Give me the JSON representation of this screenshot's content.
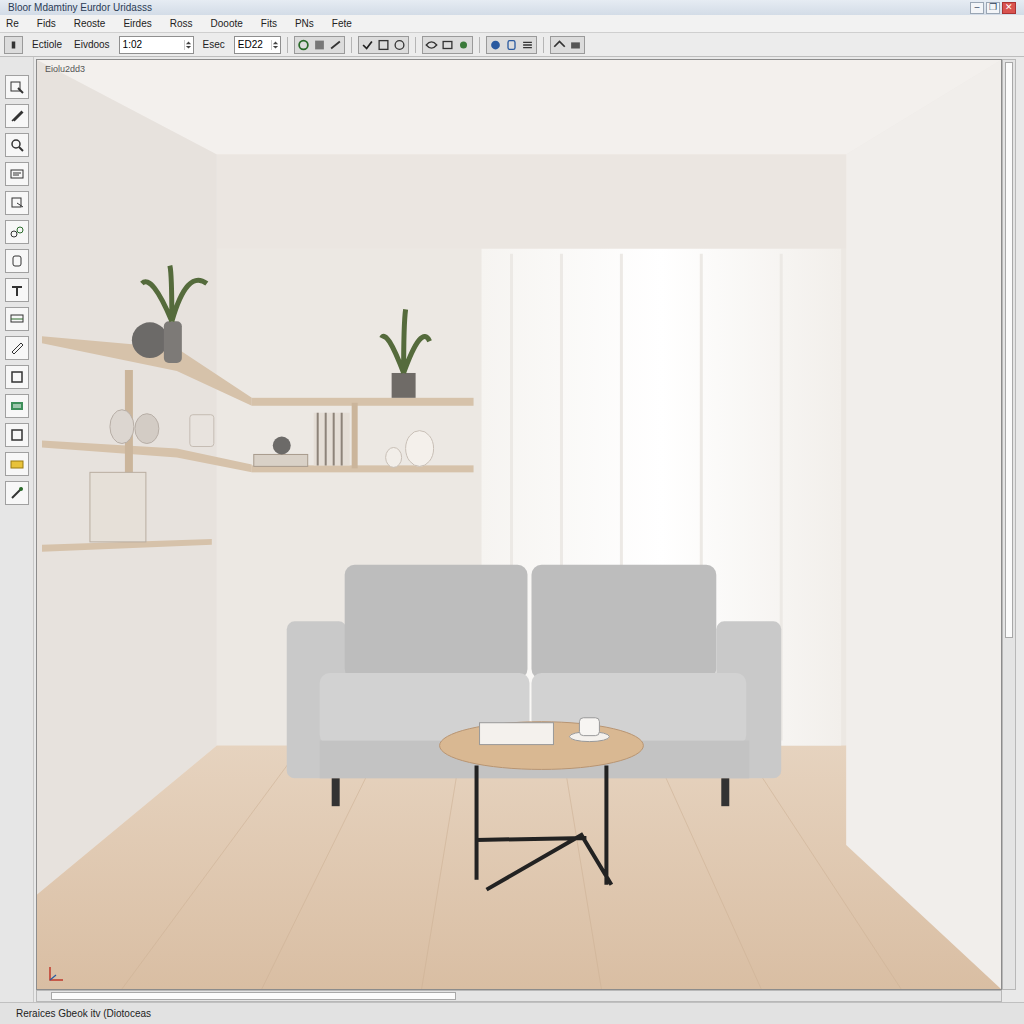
{
  "window": {
    "title": "Bloor Mdamtiny Eurdor Uridasss",
    "controls": [
      "–",
      "❐",
      "✕"
    ]
  },
  "menu": [
    "Re",
    "Fids",
    "Reoste",
    "Eirdes",
    "Ross",
    "Dooote",
    "Fits",
    "PNs",
    "Fete"
  ],
  "toolbar": {
    "items": [
      {
        "kind": "label",
        "text": "Ectiole"
      },
      {
        "kind": "label",
        "text": "Eivdoos"
      },
      {
        "kind": "field",
        "value": "1:02"
      },
      {
        "kind": "label",
        "text": "Esec"
      },
      {
        "kind": "field",
        "value": "ED22"
      }
    ]
  },
  "viewport": {
    "label": "Eiolu2dd3"
  },
  "status_bar": "Reraices Gbeok itv (Diotoceas"
}
